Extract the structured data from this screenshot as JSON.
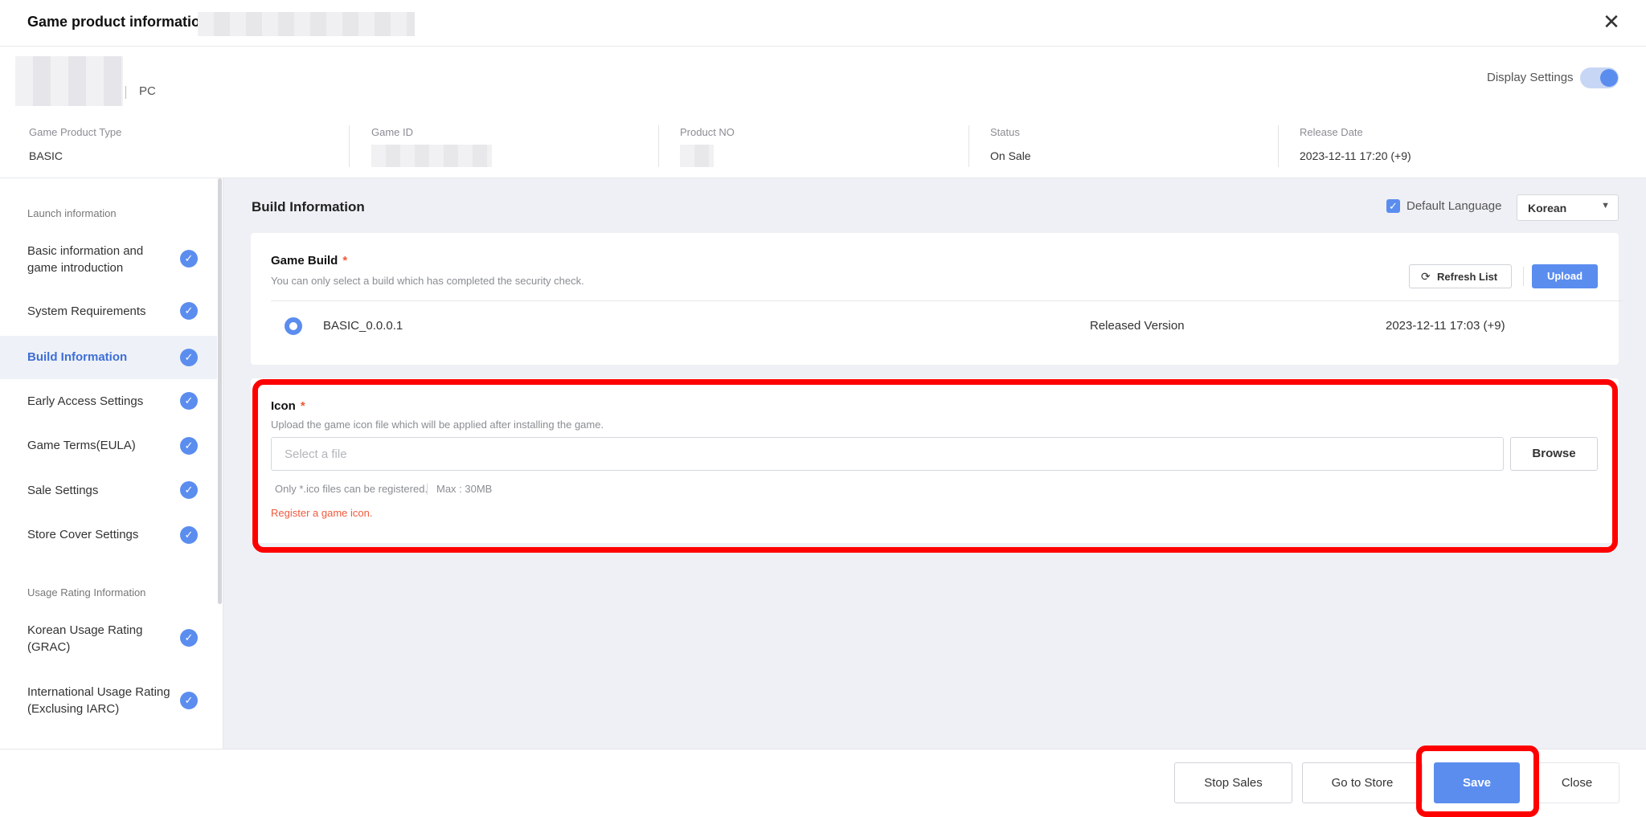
{
  "header": {
    "title": "Game product information",
    "close_symbol": "✕"
  },
  "product": {
    "platform": "PC",
    "display_settings_label": "Display Settings",
    "display_settings_on": true
  },
  "info": {
    "type_label": "Game Product Type",
    "type_value": "BASIC",
    "game_id_label": "Game ID",
    "product_no_label": "Product NO",
    "status_label": "Status",
    "status_value": "On Sale",
    "release_label": "Release Date",
    "release_value": "2023-12-11 17:20 (+9)"
  },
  "sidebar": {
    "section1": "Launch information",
    "items": [
      {
        "label": "Basic information and game introduction"
      },
      {
        "label": "System Requirements"
      },
      {
        "label": "Build Information"
      },
      {
        "label": "Early Access Settings"
      },
      {
        "label": "Game Terms(EULA)"
      },
      {
        "label": "Sale Settings"
      },
      {
        "label": "Store Cover Settings"
      }
    ],
    "section2": "Usage Rating Information",
    "items2": [
      {
        "label": "Korean Usage Rating (GRAC)"
      },
      {
        "label": "International Usage Rating (Exclusing IARC)"
      }
    ],
    "check_symbol": "✓"
  },
  "main": {
    "title": "Build Information",
    "default_language_label": "Default Language",
    "checkbox_symbol": "✓",
    "language": "Korean",
    "caret": "▼",
    "game_build": {
      "title": "Game Build",
      "required_mark": "*",
      "description": "You can only select a build which has completed the security check.",
      "refresh_label": "Refresh List",
      "refresh_icon": "⟳",
      "upload_label": "Upload",
      "row": {
        "name": "BASIC_0.0.0.1",
        "version": "Released Version",
        "date": "2023-12-11 17:03 (+9)"
      }
    },
    "icon": {
      "title": "Icon",
      "required_mark": "*",
      "description": "Upload the game icon file which will be applied after installing the game.",
      "placeholder": "Select a file",
      "browse_label": "Browse",
      "hint_format": "Only *.ico files can be registered.",
      "hint_max": "Max : 30MB",
      "error": "Register a game icon."
    }
  },
  "footer": {
    "stop_sales": "Stop Sales",
    "go_to_store": "Go to Store",
    "save": "Save",
    "close": "Close"
  },
  "colors": {
    "accent": "#5b8def",
    "error": "#ef5a3c",
    "highlight": "#ff0000"
  }
}
